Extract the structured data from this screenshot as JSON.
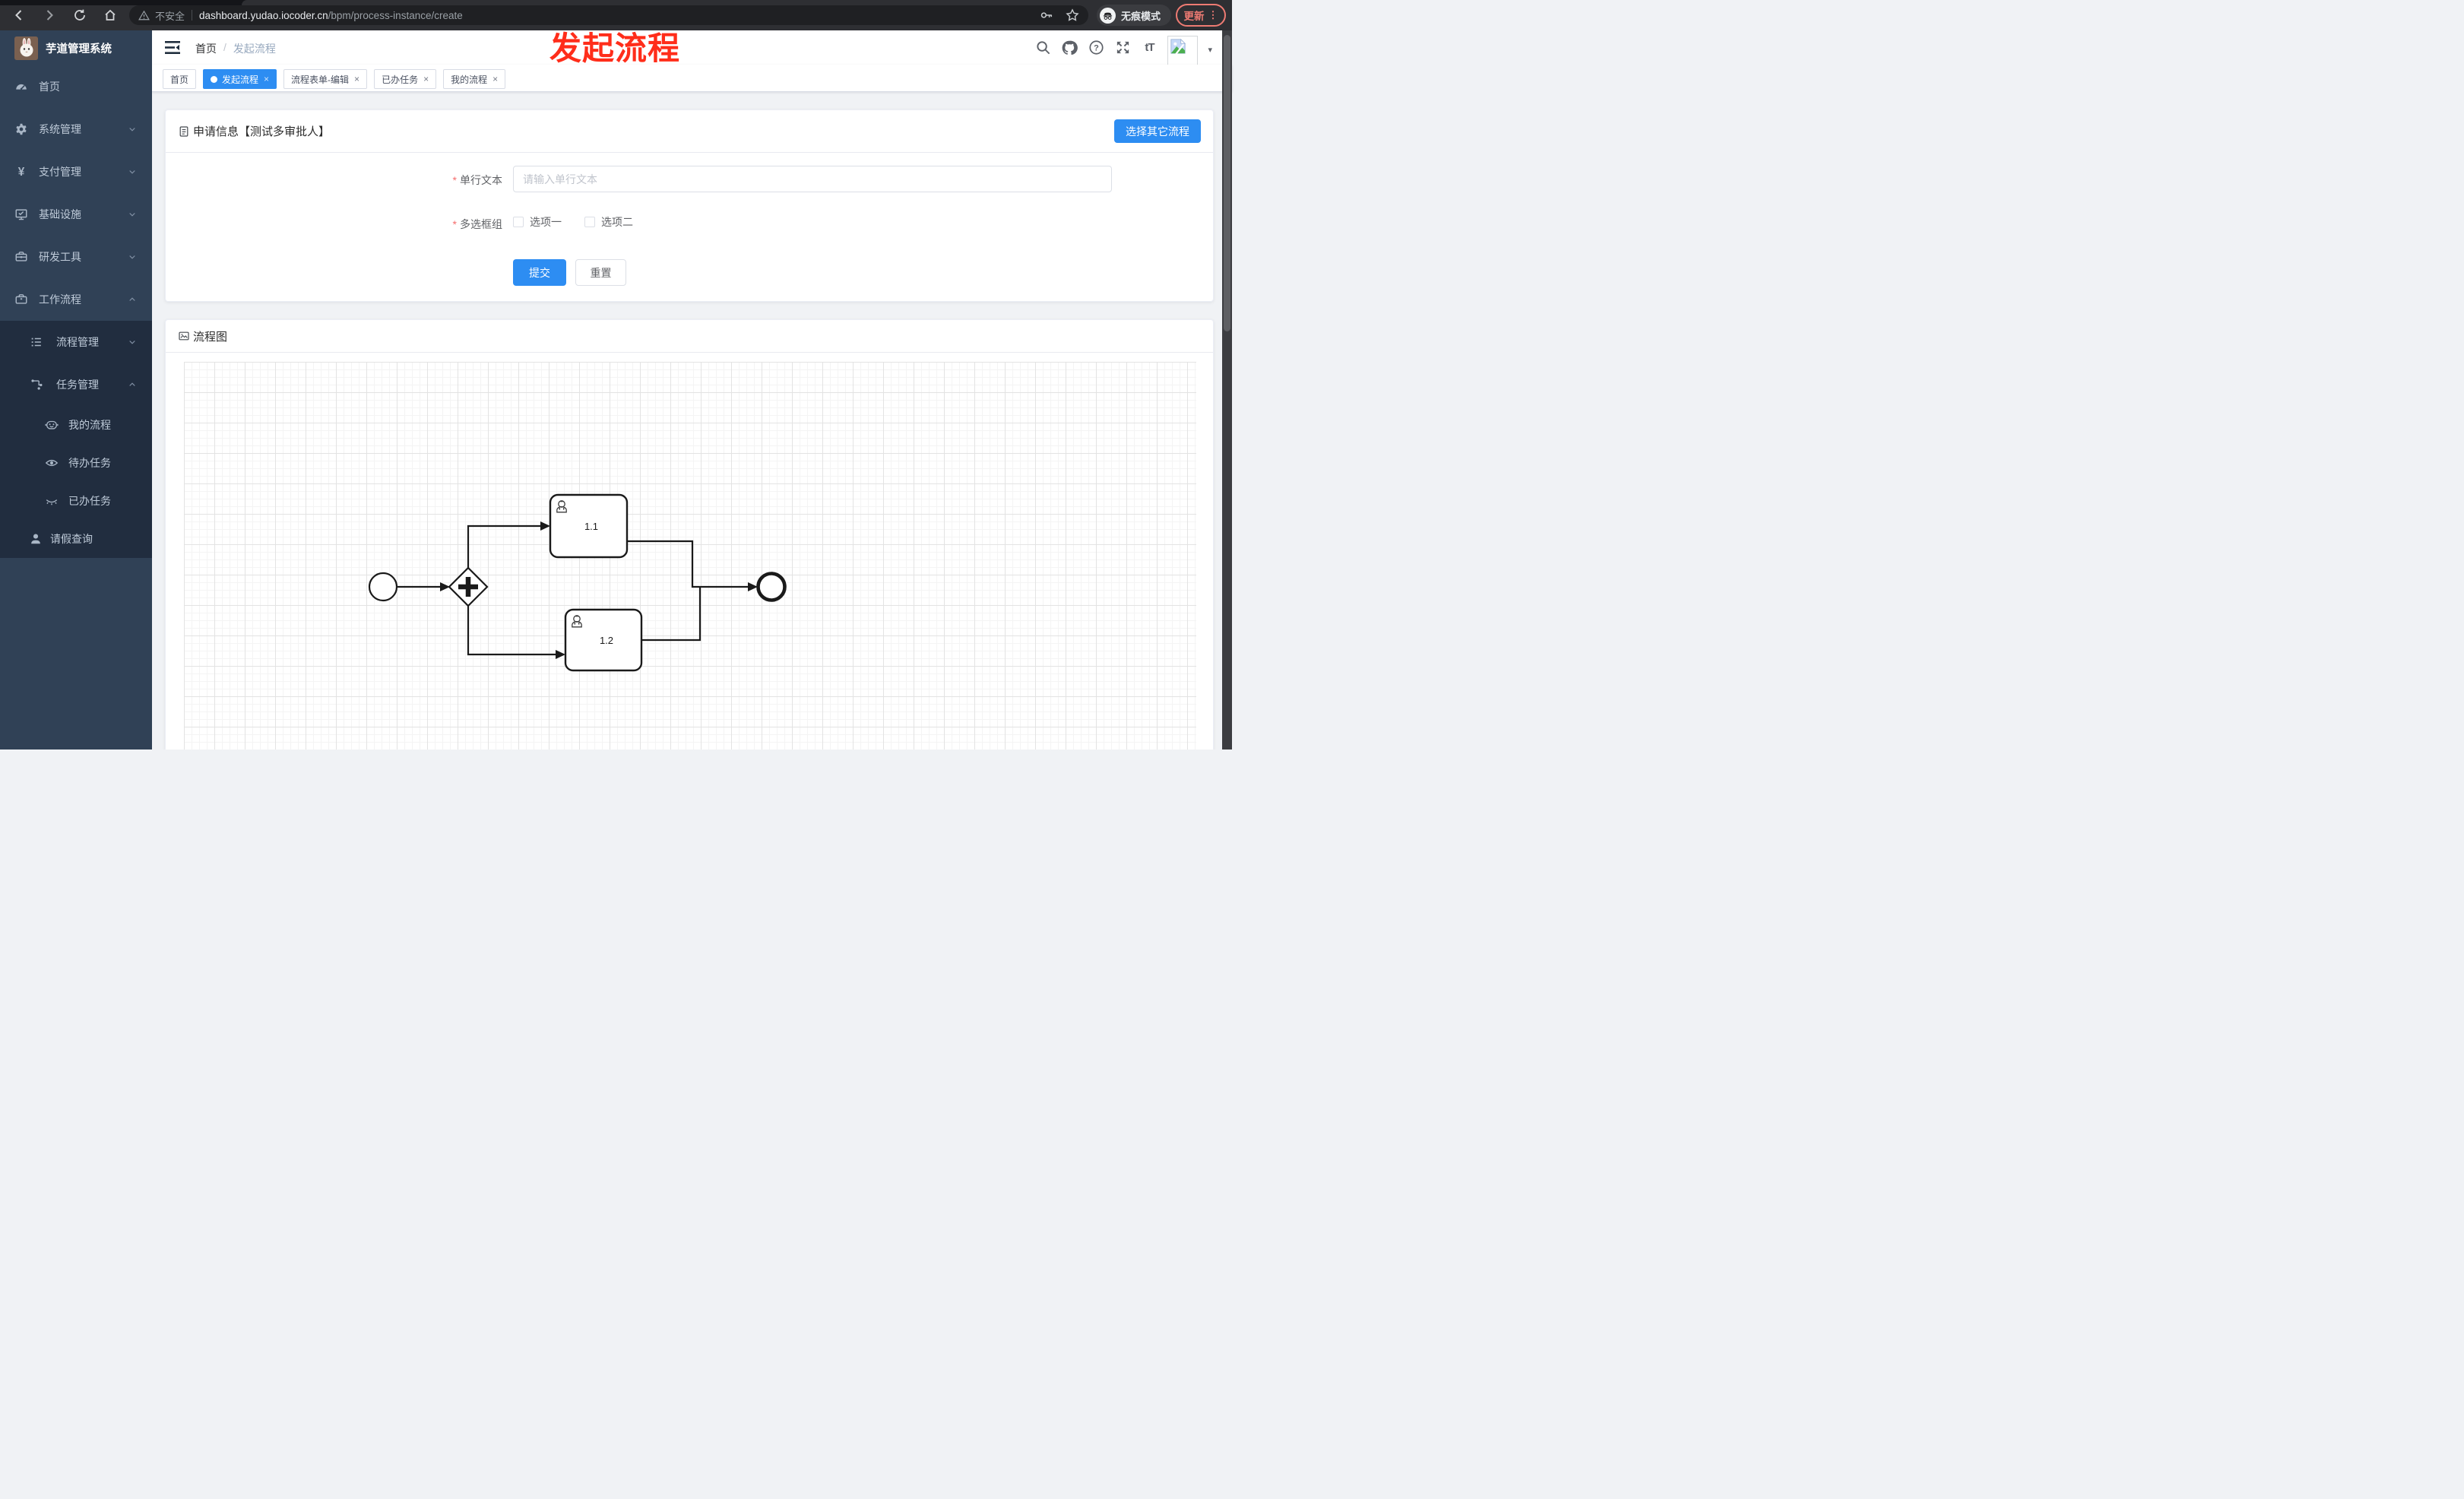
{
  "browser": {
    "security_label": "不安全",
    "url_host": "dashboard.yudao.iocoder.cn",
    "url_path": "/bpm/process-instance/create",
    "incognito_label": "无痕模式",
    "update_label": "更新"
  },
  "glyphs": {
    "yen": "¥",
    "question": "?",
    "font_size": "tT",
    "caret": "▾",
    "kebab": "⋮",
    "close": "×",
    "slash": "/",
    "asterisk": "*"
  },
  "annotation": {
    "text": "发起流程",
    "color": "#ff2d1a"
  },
  "sidebar": {
    "title": "芋道管理系统",
    "items": [
      {
        "label": "首页",
        "icon": "dashboard-icon"
      },
      {
        "label": "系统管理",
        "icon": "gear-icon",
        "chevron": "down"
      },
      {
        "label": "支付管理",
        "icon": "yen-icon",
        "chevron": "down"
      },
      {
        "label": "基础设施",
        "icon": "monitor-icon",
        "chevron": "down"
      },
      {
        "label": "研发工具",
        "icon": "toolbox-icon",
        "chevron": "down"
      },
      {
        "label": "工作流程",
        "icon": "briefcase-icon",
        "chevron": "up",
        "expanded": true
      },
      {
        "label": "流程管理",
        "icon": "tree-list-icon",
        "chevron": "down"
      },
      {
        "label": "任务管理",
        "icon": "flow-icon",
        "chevron": "up",
        "expanded": true
      },
      {
        "label": "我的流程",
        "icon": "robot-face-icon"
      },
      {
        "label": "待办任务",
        "icon": "eye-icon"
      },
      {
        "label": "已办任务",
        "icon": "eye-off-icon"
      },
      {
        "label": "请假查询",
        "icon": "user-icon"
      }
    ]
  },
  "header": {
    "breadcrumb": [
      "首页",
      "发起流程"
    ]
  },
  "tabs": {
    "items": [
      {
        "label": "首页",
        "active": false,
        "closable": false
      },
      {
        "label": "发起流程",
        "active": true,
        "closable": true
      },
      {
        "label": "流程表单-编辑",
        "active": false,
        "closable": true
      },
      {
        "label": "已办任务",
        "active": false,
        "closable": true
      },
      {
        "label": "我的流程",
        "active": false,
        "closable": true
      }
    ]
  },
  "form_card": {
    "title": "申请信息【测试多审批人】",
    "select_other_label": "选择其它流程",
    "fields": [
      {
        "label": "单行文本",
        "required": true,
        "type": "text",
        "value": "",
        "placeholder": "请输入单行文本"
      },
      {
        "label": "多选框组",
        "required": true,
        "type": "checkbox-group",
        "options": [
          {
            "label": "选项一",
            "checked": false
          },
          {
            "label": "选项二",
            "checked": false
          }
        ]
      }
    ],
    "submit_label": "提交",
    "reset_label": "重置"
  },
  "diagram_card": {
    "title": "流程图",
    "bpmn": {
      "nodes": [
        {
          "id": "start",
          "type": "startEvent",
          "label": ""
        },
        {
          "id": "gateway",
          "type": "parallelGateway",
          "label": ""
        },
        {
          "id": "task1",
          "type": "userTask",
          "label": "1.1"
        },
        {
          "id": "task2",
          "type": "userTask",
          "label": "1.2"
        },
        {
          "id": "end",
          "type": "endEvent",
          "label": ""
        }
      ],
      "flows": [
        {
          "from": "start",
          "to": "gateway"
        },
        {
          "from": "gateway",
          "to": "task1"
        },
        {
          "from": "gateway",
          "to": "task2"
        },
        {
          "from": "task1",
          "to": "end"
        },
        {
          "from": "task2",
          "to": "end"
        }
      ]
    }
  },
  "colors": {
    "primary": "#2d8df2",
    "sidebar_bg": "#304156",
    "submenu_bg": "#212d3f",
    "annotation_red": "#ff2d1a"
  }
}
